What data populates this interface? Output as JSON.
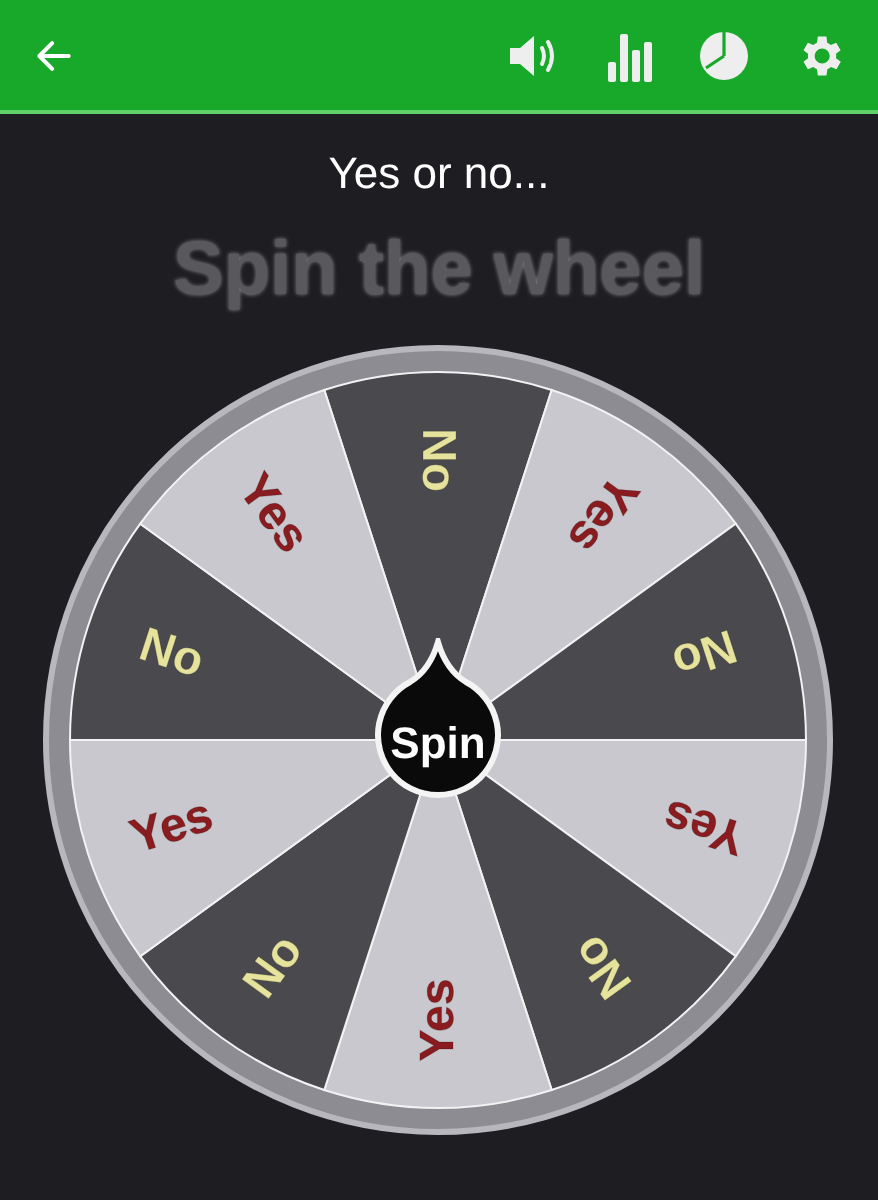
{
  "toolbar": {
    "title": "Yes or no..."
  },
  "heading": "Spin the wheel",
  "wheel": {
    "button": "Spin",
    "segments": [
      {
        "label": "No",
        "kind": "dark"
      },
      {
        "label": "Yes",
        "kind": "light"
      },
      {
        "label": "No",
        "kind": "dark"
      },
      {
        "label": "Yes",
        "kind": "light"
      },
      {
        "label": "No",
        "kind": "dark"
      },
      {
        "label": "Yes",
        "kind": "light"
      },
      {
        "label": "No",
        "kind": "dark"
      },
      {
        "label": "Yes",
        "kind": "light"
      },
      {
        "label": "No",
        "kind": "dark"
      },
      {
        "label": "Yes",
        "kind": "light"
      }
    ]
  }
}
